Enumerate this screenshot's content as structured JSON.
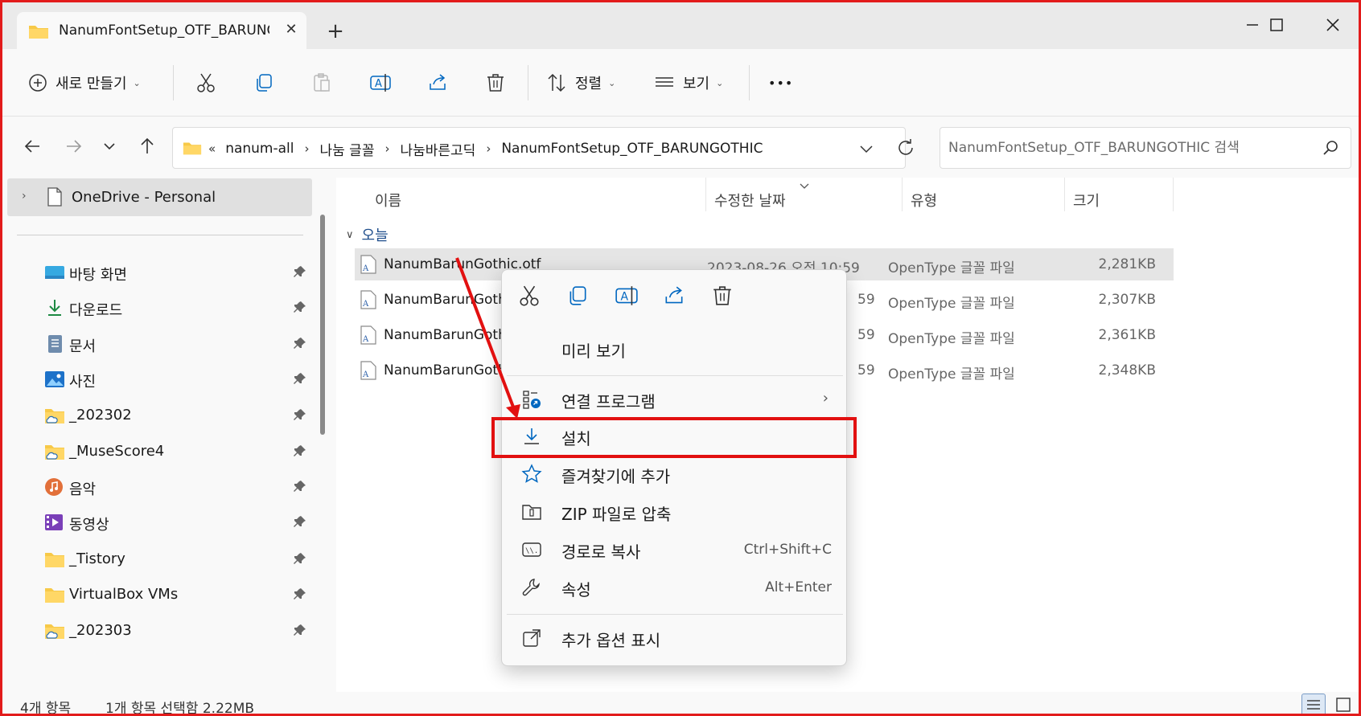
{
  "window": {
    "tab_title": "NanumFontSetup_OTF_BARUNGOTHIC",
    "new_tab": "+",
    "close_tab": "✕"
  },
  "toolbar": {
    "new_label": "새로 만들기",
    "sort_label": "정렬",
    "view_label": "보기",
    "more_label": "•••"
  },
  "address": {
    "more": "«",
    "crumbs": [
      "nanum-all",
      "나눔 글꼴",
      "나눔바른고딕",
      "NanumFontSetup_OTF_BARUNGOTHIC"
    ],
    "separator": "›"
  },
  "search": {
    "placeholder": "NanumFontSetup_OTF_BARUNGOTHIC 검색"
  },
  "sidebar": {
    "onedrive": "OneDrive - Personal",
    "items": [
      {
        "label": "바탕 화면",
        "icon": "desktop-icon"
      },
      {
        "label": "다운로드",
        "icon": "download-icon"
      },
      {
        "label": "문서",
        "icon": "documents-icon"
      },
      {
        "label": "사진",
        "icon": "pictures-icon"
      },
      {
        "label": "_202302",
        "icon": "folder-cloud-icon"
      },
      {
        "label": "_MuseScore4",
        "icon": "folder-cloud-icon"
      },
      {
        "label": "음악",
        "icon": "music-icon"
      },
      {
        "label": "동영상",
        "icon": "videos-icon"
      },
      {
        "label": "_Tistory",
        "icon": "folder-icon"
      },
      {
        "label": "VirtualBox VMs",
        "icon": "folder-icon"
      },
      {
        "label": "_202303",
        "icon": "folder-cloud-icon"
      }
    ]
  },
  "columns": {
    "name": "이름",
    "date": "수정한 날짜",
    "type": "유형",
    "size": "크기"
  },
  "group": {
    "label": "오늘"
  },
  "files": [
    {
      "name": "NanumBarunGothic.otf",
      "date": "2023-08-26 오전 10:59",
      "type": "OpenType 글꼴 파일",
      "size": "2,281KB",
      "selected": true
    },
    {
      "name": "NanumBarunGoth",
      "date": "59",
      "type": "OpenType 글꼴 파일",
      "size": "2,307KB",
      "selected": false
    },
    {
      "name": "NanumBarunGoth",
      "date": "59",
      "type": "OpenType 글꼴 파일",
      "size": "2,361KB",
      "selected": false
    },
    {
      "name": "NanumBarunGoth",
      "date": "59",
      "type": "OpenType 글꼴 파일",
      "size": "2,348KB",
      "selected": false
    }
  ],
  "context_menu": {
    "preview": "미리 보기",
    "open_with": "연결 프로그램",
    "install": "설치",
    "favorites": "즐겨찾기에 추가",
    "zip": "ZIP 파일로 압축",
    "copy_path": "경로로 복사",
    "copy_path_shortcut": "Ctrl+Shift+C",
    "properties": "속성",
    "properties_shortcut": "Alt+Enter",
    "more_options": "추가 옵션 표시"
  },
  "status": {
    "count": "4개 항목",
    "selection": "1개 항목 선택함 2.22MB"
  },
  "colors": {
    "accent": "#0067c0",
    "annotation_red": "#e21010"
  }
}
